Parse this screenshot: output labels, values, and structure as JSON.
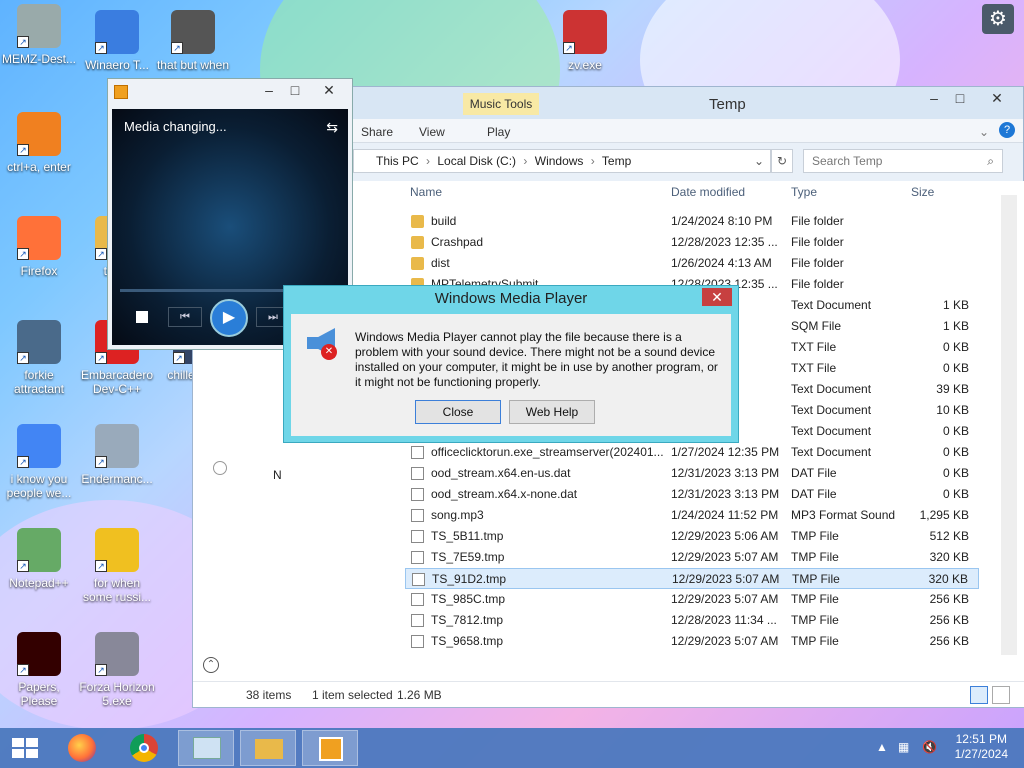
{
  "desktop": {
    "icons": [
      {
        "label": "MEMZ-Dest...",
        "name": "memz-destructive-icon"
      },
      {
        "label": "Winaero T...",
        "name": "winaero-tweaker-icon"
      },
      {
        "label": "that but when ...",
        "name": "that-but-when-icon"
      },
      {
        "label": "zv.exe",
        "name": "zv-exe-icon"
      },
      {
        "label": "ctrl+a, enter",
        "name": "ctrl-a-enter-icon"
      },
      {
        "label": "Firefox",
        "name": "firefox-icon"
      },
      {
        "label": "the...",
        "name": "the-icon"
      },
      {
        "label": "forkie attractant",
        "name": "forkie-attractant-icon"
      },
      {
        "label": "Embarcadero Dev-C++",
        "name": "embarcadero-devcpp-icon"
      },
      {
        "label": "chille... (1)",
        "name": "chille-icon"
      },
      {
        "label": "i know you people we...",
        "name": "i-know-you-people-icon"
      },
      {
        "label": "Endermanc...",
        "name": "endermanch-icon"
      },
      {
        "label": "Notepad++",
        "name": "notepadpp-icon"
      },
      {
        "label": "for when some russi...",
        "name": "for-when-some-russi-icon"
      },
      {
        "label": "Papers, Please",
        "name": "papers-please-icon"
      },
      {
        "label": "Forza Horizon 5.exe",
        "name": "forza-horizon-icon"
      }
    ]
  },
  "explorer": {
    "title": "Temp",
    "ribbon": {
      "music_tools": "Music Tools",
      "share": "Share",
      "view": "View",
      "play": "Play"
    },
    "breadcrumb": [
      "This PC",
      "Local Disk (C:)",
      "Windows",
      "Temp"
    ],
    "search_placeholder": "Search Temp",
    "columns": {
      "name": "Name",
      "date": "Date modified",
      "type": "Type",
      "size": "Size"
    },
    "nav_partial": "N",
    "rows": [
      {
        "name": "build",
        "date": "1/24/2024 8:10 PM",
        "type": "File folder",
        "size": "",
        "kind": "folder"
      },
      {
        "name": "Crashpad",
        "date": "12/28/2023 12:35 ...",
        "type": "File folder",
        "size": "",
        "kind": "folder"
      },
      {
        "name": "dist",
        "date": "1/26/2024 4:13 AM",
        "type": "File folder",
        "size": "",
        "kind": "folder"
      },
      {
        "name": "MPTelemetrySubmit",
        "date": "12/28/2023 12:35 ...",
        "type": "File folder",
        "size": "",
        "kind": "folder"
      },
      {
        "name": "",
        "date": "...6 PM",
        "type": "Text Document",
        "size": "1 KB",
        "kind": "file"
      },
      {
        "name": "",
        "date": "...37 PM",
        "type": "SQM File",
        "size": "1 KB",
        "kind": "file"
      },
      {
        "name": "",
        "date": "...08 AM",
        "type": "TXT File",
        "size": "0 KB",
        "kind": "file"
      },
      {
        "name": "",
        "date": "...08 AM",
        "type": "TXT File",
        "size": "0 KB",
        "kind": "file"
      },
      {
        "name": "",
        "date": "...45 PM",
        "type": "Text Document",
        "size": "39 KB",
        "kind": "file"
      },
      {
        "name": "",
        "date": "...14 PM",
        "type": "Text Document",
        "size": "10 KB",
        "kind": "file"
      },
      {
        "name": "",
        "date": "...35 PM",
        "type": "Text Document",
        "size": "0 KB",
        "kind": "file"
      },
      {
        "name": "officeclicktorun.exe_streamserver(202401...",
        "date": "1/27/2024 12:35 PM",
        "type": "Text Document",
        "size": "0 KB",
        "kind": "file"
      },
      {
        "name": "ood_stream.x64.en-us.dat",
        "date": "12/31/2023 3:13 PM",
        "type": "DAT File",
        "size": "0 KB",
        "kind": "file"
      },
      {
        "name": "ood_stream.x64.x-none.dat",
        "date": "12/31/2023 3:13 PM",
        "type": "DAT File",
        "size": "0 KB",
        "kind": "file"
      },
      {
        "name": "song.mp3",
        "date": "1/24/2024 11:52 PM",
        "type": "MP3 Format Sound",
        "size": "1,295 KB",
        "kind": "audio"
      },
      {
        "name": "TS_5B11.tmp",
        "date": "12/29/2023 5:06 AM",
        "type": "TMP File",
        "size": "512 KB",
        "kind": "file"
      },
      {
        "name": "TS_7E59.tmp",
        "date": "12/29/2023 5:07 AM",
        "type": "TMP File",
        "size": "320 KB",
        "kind": "file"
      },
      {
        "name": "TS_91D2.tmp",
        "date": "12/29/2023 5:07 AM",
        "type": "TMP File",
        "size": "320 KB",
        "kind": "file",
        "selected": true
      },
      {
        "name": "TS_985C.tmp",
        "date": "12/29/2023 5:07 AM",
        "type": "TMP File",
        "size": "256 KB",
        "kind": "file"
      },
      {
        "name": "TS_7812.tmp",
        "date": "12/28/2023 11:34 ...",
        "type": "TMP File",
        "size": "256 KB",
        "kind": "file"
      },
      {
        "name": "TS_9658.tmp",
        "date": "12/29/2023 5:07 AM",
        "type": "TMP File",
        "size": "256 KB",
        "kind": "file"
      }
    ],
    "status": {
      "count": "38 items",
      "selected": "1 item selected",
      "size": "1.26 MB"
    }
  },
  "wmp": {
    "status_text": "Media changing..."
  },
  "dialog": {
    "title": "Windows Media Player",
    "message": "Windows Media Player cannot play the file because there is a problem with your sound device. There might not be a sound device installed on your computer, it might be in use by another program, or it might not be functioning properly.",
    "close_label": "Close",
    "help_label": "Web Help"
  },
  "taskbar": {
    "time": "12:51 PM",
    "date": "1/27/2024"
  }
}
